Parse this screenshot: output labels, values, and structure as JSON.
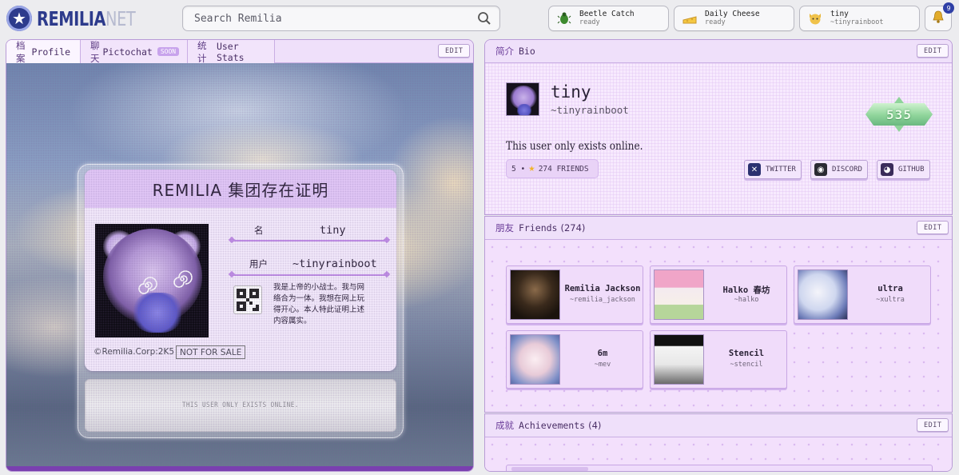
{
  "topbar": {
    "logo_main": "REMILIA",
    "logo_suffix": "NET",
    "search_placeholder": "Search Remilia",
    "chips": [
      {
        "title": "Beetle Catch",
        "sub": "ready",
        "icon": "beetle-icon"
      },
      {
        "title": "Daily Cheese",
        "sub": "ready",
        "icon": "cheese-icon"
      },
      {
        "title": "tiny",
        "sub": "~tinyrainboot",
        "icon": "cat-avatar-icon"
      }
    ],
    "notifications": "9"
  },
  "left": {
    "tabs": [
      {
        "cn": "档案",
        "label": "Profile"
      },
      {
        "cn": "聊天",
        "label": "Pictochat",
        "badge": "SOON"
      },
      {
        "cn": "统计",
        "label": "User Stats"
      }
    ],
    "edit_label": "EDIT",
    "card": {
      "title": "REMILIA 集团存在证明",
      "name_label": "名",
      "name_value": "tiny",
      "user_label": "用户",
      "user_value": "~tinyrainboot",
      "description": "我是上帝的小战士。我与网络合为一体。我想在网上玩得开心。本人特此证明上述内容属实。",
      "copyright": "©Remilia.Corp:2K5",
      "not_for_sale": "NOT FOR SALE",
      "signature": "THIS USER ONLY EXISTS ONLINE."
    }
  },
  "bio": {
    "header_cn": "简介",
    "header": "Bio",
    "edit_label": "EDIT",
    "name": "tiny",
    "handle": "~tinyrainboot",
    "text": "This user only exists online.",
    "score": "535",
    "friends_pill_prefix": "5 •",
    "friends_pill": "274 FRIENDS",
    "socials": [
      {
        "label": "TWITTER",
        "icon": "x-icon",
        "color": "#2b3170"
      },
      {
        "label": "DISCORD",
        "icon": "discord-icon",
        "color": "#2b2b33"
      },
      {
        "label": "GITHUB",
        "icon": "github-icon",
        "color": "#3a2c5a"
      }
    ]
  },
  "friends": {
    "header_cn": "朋友",
    "header": "Friends",
    "count": "(274)",
    "edit_label": "EDIT",
    "items": [
      {
        "name": "Remilia Jackson",
        "handle": "~remilia_jackson"
      },
      {
        "name": "Halko 春坊",
        "handle": "~halko"
      },
      {
        "name": "ultra",
        "handle": "~xultra"
      },
      {
        "name": "6m",
        "handle": "~mev"
      },
      {
        "name": "Stencil",
        "handle": "~stencil"
      }
    ]
  },
  "achievements": {
    "header_cn": "成就",
    "header": "Achievements",
    "count": "(4)",
    "edit_label": "EDIT"
  }
}
